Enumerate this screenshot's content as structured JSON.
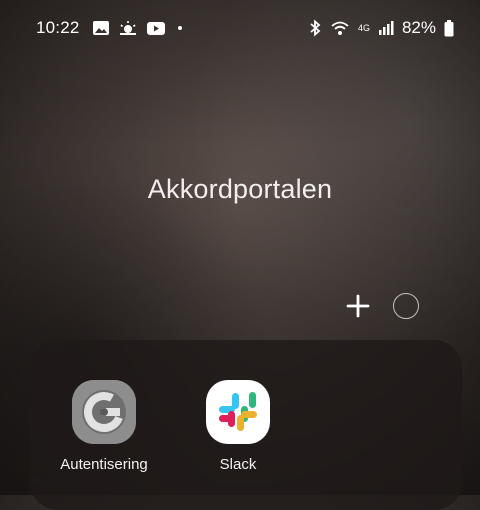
{
  "status_bar": {
    "time": "10:22",
    "battery": "82%",
    "network_type": "4G",
    "left_icons": [
      "gallery-icon",
      "weather-icon",
      "youtube-icon"
    ],
    "right_icons": [
      "bluetooth-icon",
      "wifi-icon",
      "signal-icon",
      "battery-icon"
    ]
  },
  "folder": {
    "title": "Akkordportalen",
    "apps": [
      {
        "label": "Autentisering",
        "icon": "google-authenticator-icon"
      },
      {
        "label": "Slack",
        "icon": "slack-icon"
      }
    ]
  },
  "controls": {
    "add_icon": "plus-icon",
    "page_indicator": "page-indicator-dot"
  },
  "colors": {
    "folder_bg": "#1e1a19",
    "authenticator_gray": "#8d8d8d",
    "slack_blue": "#36C5F0",
    "slack_green": "#2EB67D",
    "slack_yellow": "#ECB22E",
    "slack_red": "#E01E5A"
  }
}
